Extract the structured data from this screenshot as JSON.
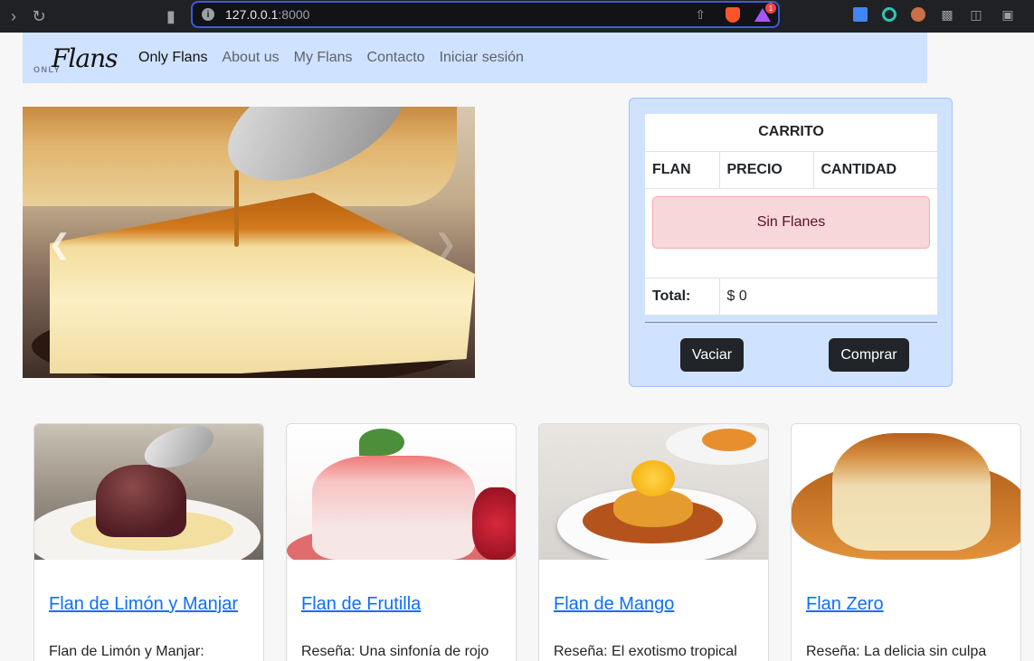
{
  "browser": {
    "url_host": "127.0.0.1",
    "url_port": ":8000",
    "rewards_badge": "1"
  },
  "navbar": {
    "brand_small": "ONLY",
    "brand_script": "Flans",
    "links": [
      {
        "label": "Only Flans",
        "active": true
      },
      {
        "label": "About us"
      },
      {
        "label": "My Flans"
      },
      {
        "label": "Contacto"
      },
      {
        "label": "Iniciar sesión"
      }
    ]
  },
  "carousel": {
    "prev_icon": "chevron-left-icon",
    "next_icon": "chevron-right-icon"
  },
  "cart": {
    "title": "CARRITO",
    "columns": [
      "FLAN",
      "PRECIO",
      "CANTIDAD"
    ],
    "empty_message": "Sin Flanes",
    "total_label": "Total:",
    "total_value": "$ 0",
    "empty_button": "Vaciar",
    "buy_button": "Comprar"
  },
  "products": [
    {
      "name": "Flan de Limón y Manjar",
      "desc": "Flan de Limón y Manjar:"
    },
    {
      "name": "Flan de Frutilla",
      "desc": "Reseña: Una sinfonía de rojo"
    },
    {
      "name": "Flan de Mango",
      "desc": "Reseña: El exotismo tropical"
    },
    {
      "name": "Flan Zero",
      "desc": "Reseña: La delicia sin culpa"
    }
  ],
  "colors": {
    "navbar_bg": "#cfe2ff",
    "link_primary": "#0d6efd",
    "alert_bg": "#f8d7da",
    "button_dark": "#212529"
  }
}
